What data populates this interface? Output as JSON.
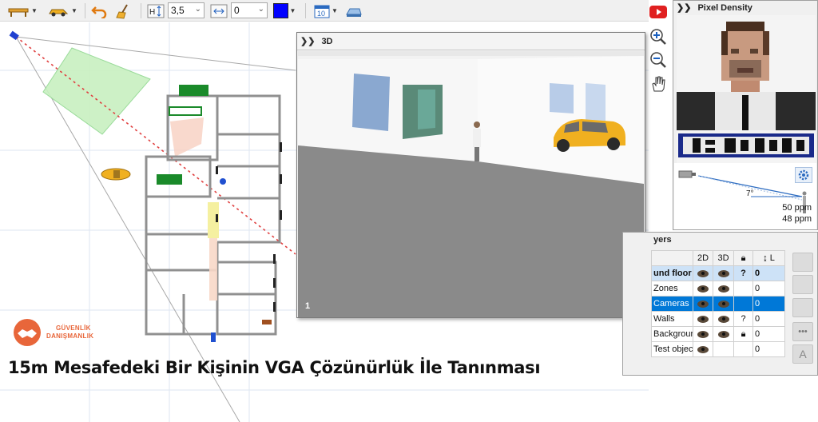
{
  "toolbar": {
    "line_width_value": "3,5",
    "offset_value": "0",
    "color_swatch": "#0000ff",
    "calendar_value": "10",
    "height_label": "H"
  },
  "window_3d": {
    "title": "3D",
    "camera_number": "1"
  },
  "pixel_density": {
    "title": "Pixel Density",
    "angle": "7°",
    "ppm_top": "50 ppm",
    "ppm_bottom": "48 ppm"
  },
  "layers": {
    "title": "yers",
    "columns": [
      "2D",
      "3D",
      "",
      "L"
    ],
    "rows": [
      {
        "name": "und floor",
        "value": "0",
        "lock": "?"
      },
      {
        "name": "Zones",
        "value": "0",
        "lock": ""
      },
      {
        "name": "Cameras",
        "value": "0",
        "lock": ""
      },
      {
        "name": "Walls",
        "value": "0",
        "lock": "?"
      },
      {
        "name": "Backgrour",
        "value": "0",
        "lock": "lock"
      },
      {
        "name": "Test object",
        "value": "0",
        "lock": ""
      }
    ],
    "side_button_label": "A"
  },
  "brand": {
    "line1": "GÜVENLİK",
    "line2": "DANIŞMANLIK",
    "color": "#e8663a"
  },
  "caption": "15m Mesafedeki Bir Kişinin VGA Çözünürlük İle Tanınması",
  "colors": {
    "selection_blue": "#0078d7",
    "fov_green": "#c8f0c0",
    "floor_gray": "#8a8a8a",
    "car_yellow": "#f0b020"
  }
}
